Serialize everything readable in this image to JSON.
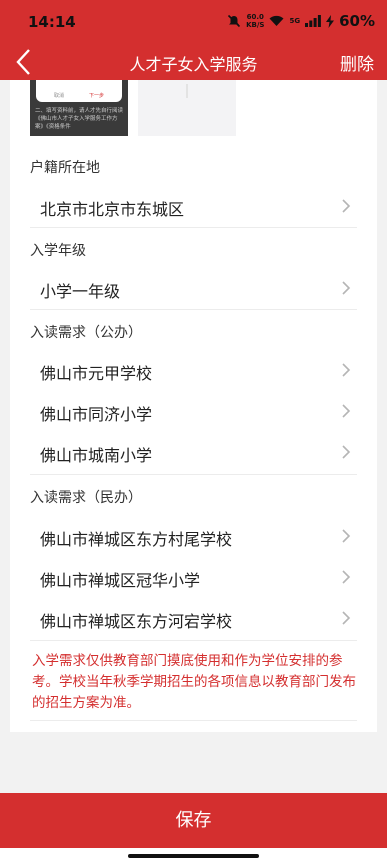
{
  "status_bar": {
    "time": "14:14",
    "net_speed_top": "60.0",
    "net_speed_bottom": "KB/S",
    "network": "5G",
    "battery": "60%"
  },
  "nav": {
    "title": "人才子女入学服务",
    "delete_label": "删除"
  },
  "thumbnails": {
    "doc_left_btn": "取消",
    "doc_right_btn": "下一步",
    "doc_text": "二、填写资料前，请人才先自行阅读《佛山市人才子女入学服务工作方案》《资格条件"
  },
  "household": {
    "label": "户籍所在地",
    "value": "北京市北京市东城区"
  },
  "grade": {
    "label": "入学年级",
    "value": "小学一年级"
  },
  "public_schools": {
    "label": "入读需求（公办）",
    "items": [
      "佛山市元甲学校",
      "佛山市同济小学",
      "佛山市城南小学"
    ]
  },
  "private_schools": {
    "label": "入读需求（民办）",
    "items": [
      "佛山市禅城区东方村尾学校",
      "佛山市禅城区冠华小学",
      "佛山市禅城区东方河宕学校"
    ]
  },
  "notice": "入学需求仅供教育部门摸底使用和作为学位安排的参考。学校当年秋季学期招生的各项信息以教育部门发布的招生方案为准。",
  "save_label": "保存",
  "colors": {
    "brand": "#d42f2f",
    "notice_text": "#d42f2f"
  },
  "icons": {
    "back": "chevron-left-icon",
    "row_arrow": "chevron-right-icon"
  }
}
